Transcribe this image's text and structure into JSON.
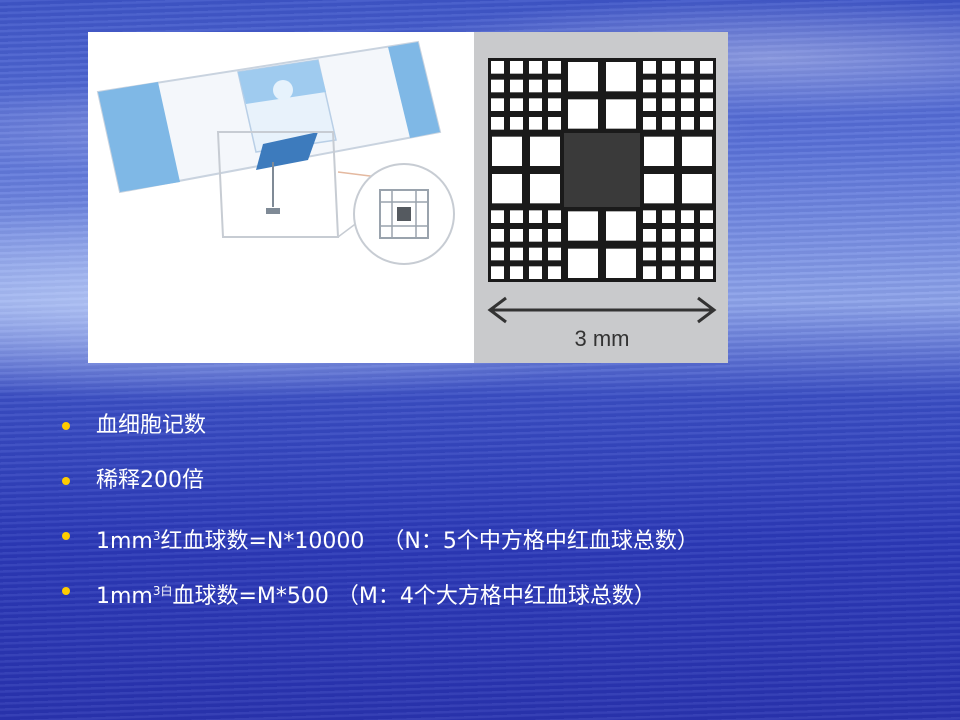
{
  "figure": {
    "scale_label": "3 mm"
  },
  "bullets": [
    {
      "text": "血细胞记数"
    },
    {
      "text": "稀释200倍"
    },
    {
      "prefix": "1mm",
      "sup": "3",
      "text": "红血球数=N*10000",
      "note": "（N：5个中方格中红血球总数）"
    },
    {
      "prefix": "1mm",
      "sup": "3白",
      "text": "血球数=M*500",
      "note": "（M：4个大方格中红血球总数）"
    }
  ],
  "colors": {
    "bullet": "#ffcc00",
    "text": "#ffffff",
    "slide_blue": "#7fb8e6"
  }
}
